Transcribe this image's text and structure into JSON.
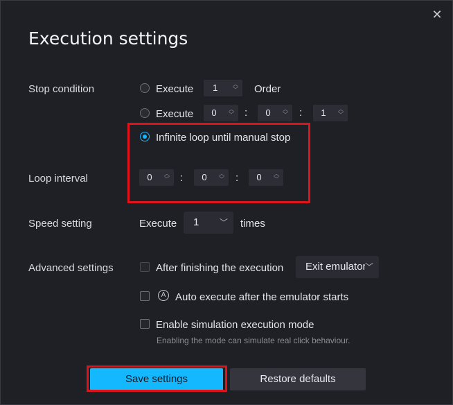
{
  "dialog": {
    "title": "Execution settings",
    "close_icon": "close-icon"
  },
  "stop_condition": {
    "label": "Stop condition",
    "option1": {
      "prefix": "Execute",
      "value": "1",
      "suffix": "Order",
      "selected": false
    },
    "option2": {
      "prefix": "Execute",
      "hours": "0",
      "minutes": "0",
      "seconds": "1",
      "selected": false
    },
    "option3": {
      "label": "Infinite loop until manual stop",
      "selected": true
    },
    "separator": ":"
  },
  "loop_interval": {
    "label": "Loop interval",
    "hours": "0",
    "minutes": "0",
    "seconds": "0"
  },
  "speed": {
    "label": "Speed setting",
    "prefix": "Execute",
    "value": "1",
    "suffix": "times"
  },
  "advanced": {
    "label": "Advanced settings",
    "after_finish": {
      "label": "After finishing the execution",
      "value": "Exit emulator",
      "checked": false
    },
    "auto_execute": {
      "label": "Auto execute after the emulator starts",
      "icon_glyph": "A",
      "checked": false
    },
    "simulation": {
      "label": "Enable simulation execution mode",
      "hint": "Enabling the mode can simulate real click behaviour.",
      "checked": false
    }
  },
  "buttons": {
    "save": "Save settings",
    "restore": "Restore defaults"
  },
  "colors": {
    "accent": "#14b8ff",
    "highlight": "#e0131b",
    "background": "#1f2025"
  }
}
